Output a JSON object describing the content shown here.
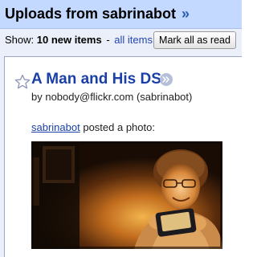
{
  "feed": {
    "title": "Uploads from sabrinabot",
    "title_arrow": "»"
  },
  "toolbar": {
    "show_label": "Show:",
    "new_items": "10 new items",
    "separator": "-",
    "all_items_link": "all items",
    "mark_all_read_label": "Mark all as read"
  },
  "entry": {
    "title": "A Man and His DS",
    "author": "by nobody@flickr.com (sabrinabot)",
    "user_link": "sabrinabot",
    "posted_text": "posted a photo:",
    "starred": false
  },
  "colors": {
    "header_bg": "#c3d9ff",
    "toolbar_bg": "#ebeff9",
    "link": "#1a3fa6",
    "accent_arrow": "#2a5db0"
  },
  "icons": {
    "star": "star-outline-icon",
    "title_arrow": "arrow-circle-icon"
  }
}
